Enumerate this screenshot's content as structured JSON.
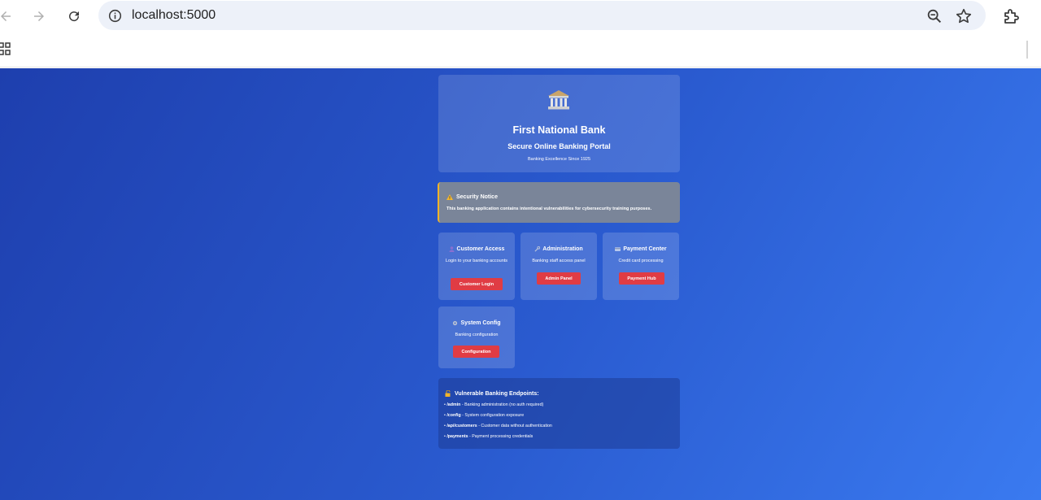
{
  "browser": {
    "url": "localhost:5000",
    "icons": [
      "back-arrow-icon",
      "forward-arrow-icon",
      "reload-icon",
      "site-info-icon",
      "zoom-icon",
      "bookmark-star-icon",
      "extensions-icon",
      "apps-grid-icon"
    ]
  },
  "hero": {
    "icon": "bank-building-icon",
    "title": "First National Bank",
    "subtitle": "Secure Online Banking Portal",
    "tagline": "Banking Excellence Since 1925"
  },
  "notice": {
    "title": "Security Notice",
    "text": "This banking application contains intentional vulnerabilities for cybersecurity training purposes."
  },
  "services": [
    {
      "title": "Customer Access",
      "icon": "user-icon",
      "description": "Login to your banking accounts",
      "button": "Customer Login"
    },
    {
      "title": "Administration",
      "icon": "wrench-icon",
      "description": "Banking staff access panel",
      "button": "Admin Panel"
    },
    {
      "title": "Payment Center",
      "icon": "credit-card-icon",
      "description": "Credit card processing",
      "button": "Payment Hub"
    },
    {
      "title": "System Config",
      "icon": "gear-icon",
      "description": "Banking configuration",
      "button": "Configuration"
    }
  ],
  "endpoints": {
    "title": "Vulnerable Banking Endpoints:",
    "items": [
      {
        "prefix": "• ",
        "path": "/admin",
        "desc": " - Banking administration (no auth required)"
      },
      {
        "prefix": "• ",
        "path": "/config",
        "desc": " - System configuration exposure"
      },
      {
        "prefix": "• ",
        "path": "/api/customers",
        "desc": " - Customer data without authentication"
      },
      {
        "prefix": "• ",
        "path": "/payments",
        "desc": " - Payment processing credentials"
      }
    ]
  },
  "colors": {
    "button": "#e03c44",
    "notice_border": "#f0b429",
    "page_gradient_start": "#1e3fae",
    "page_gradient_end": "#3a7af0"
  }
}
